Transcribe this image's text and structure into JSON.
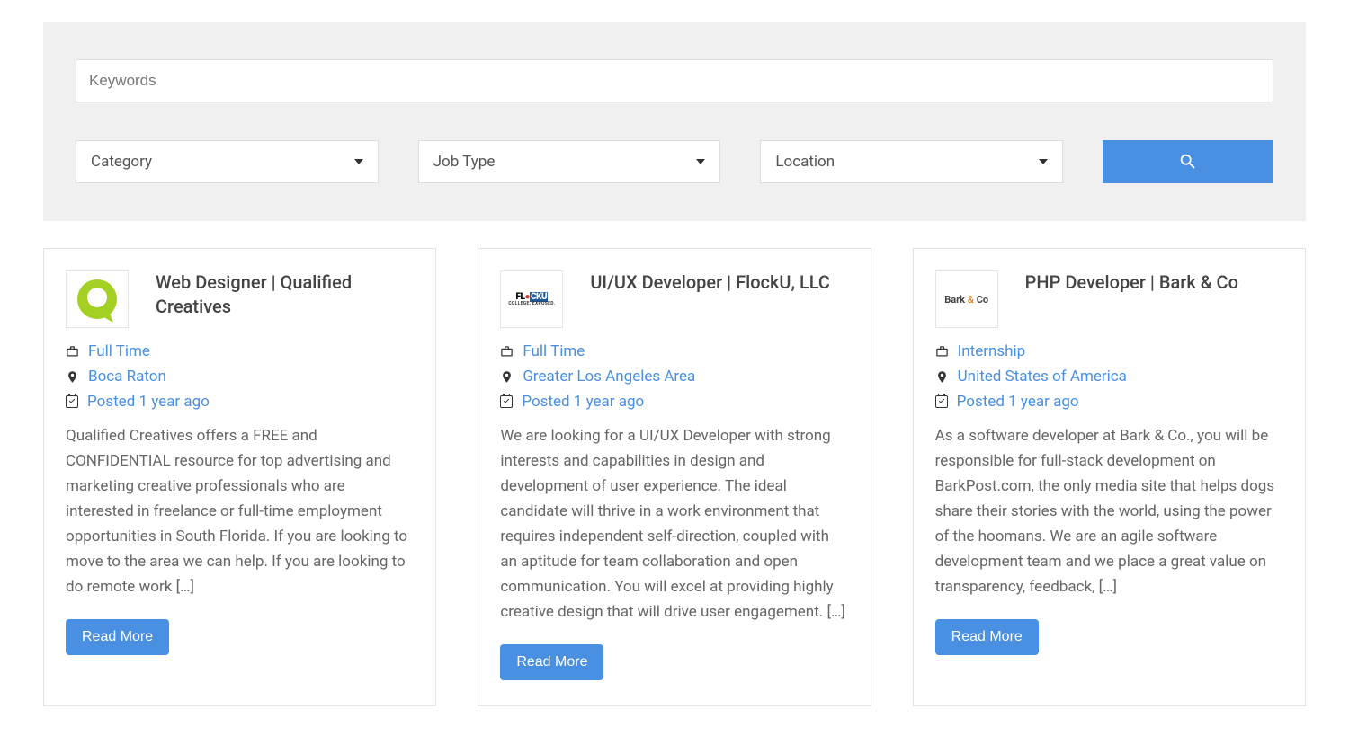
{
  "search": {
    "keywords_placeholder": "Keywords",
    "category_label": "Category",
    "jobtype_label": "Job Type",
    "location_label": "Location"
  },
  "jobs": [
    {
      "title": "Web Designer | Qualified Creatives",
      "job_type": "Full Time",
      "location": "Boca Raton",
      "posted": "Posted 1 year ago",
      "description": "Qualified Creatives offers a FREE and CONFIDENTIAL resource for top advertising and marketing creative professionals who are interested in freelance or full-time employment opportunities in South Florida. If you are looking to move to the area we can help. If you are looking to do remote work […]",
      "read_more": "Read More"
    },
    {
      "title": "UI/UX Developer | FlockU, LLC",
      "job_type": "Full Time",
      "location": "Greater Los Angeles Area",
      "posted": "Posted 1 year ago",
      "description": "We are looking for a UI/UX Developer with strong interests and capabilities in design and development of user experience.  The ideal candidate will thrive in a work environment that requires independent self-direction, coupled with an aptitude for team collaboration and open communication.  You will excel at providing highly creative design that will drive user engagement.  […]",
      "read_more": "Read More"
    },
    {
      "title": "PHP Developer | Bark & Co",
      "job_type": "Internship",
      "location": "United States of America",
      "posted": "Posted 1 year ago",
      "description": "As a software developer at Bark & Co., you will be responsible for full-stack development on BarkPost.com, the only media site that helps dogs share their stories with the world, using the power of the hoomans. We are an agile software development team and we place a great value on transparency, feedback, […]",
      "read_more": "Read More"
    }
  ]
}
